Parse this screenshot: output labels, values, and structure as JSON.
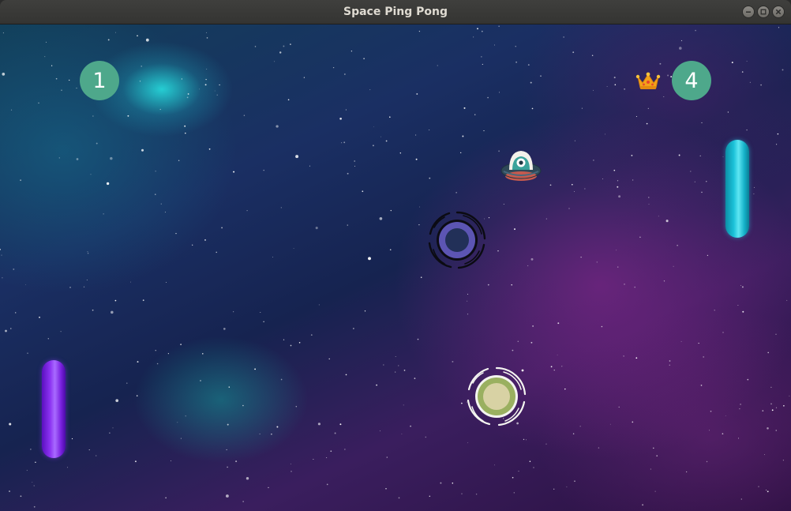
{
  "window": {
    "title": "Space Ping Pong",
    "controls": [
      "minimize",
      "maximize",
      "close"
    ]
  },
  "game": {
    "left_score": "1",
    "right_score": "4",
    "leader": "right",
    "leader_icon": "crown-icon",
    "colors": {
      "score_badge": "#4ea88b",
      "left_paddle": "#8c33f2",
      "right_paddle": "#1bc2d9",
      "blue_portal": "#5c55b3",
      "green_portal": "#9ab060",
      "crown": "#f2a21a"
    },
    "objects": [
      "left-paddle",
      "right-paddle",
      "ufo-ball",
      "blue-black-hole-portal",
      "green-white-hole-portal"
    ]
  }
}
